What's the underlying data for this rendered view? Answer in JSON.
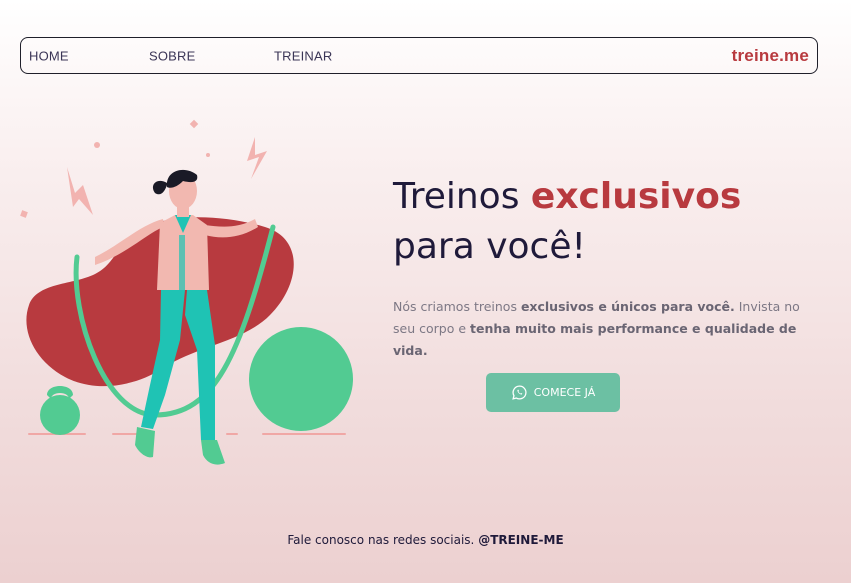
{
  "nav": {
    "home": "HOME",
    "sobre": "SOBRE",
    "treinar": "TREINAR",
    "brand": "treine.me"
  },
  "hero": {
    "title_part1": "Treinos ",
    "title_accent": "exclusivos",
    "title_part2": "para você!",
    "desc_part1": "Nós criamos treinos ",
    "desc_bold1": "exclusivos e únicos para você.",
    "desc_part2": " Invista no seu corpo e ",
    "desc_bold2": "tenha muito mais performance e qualidade de vida.",
    "cta_label": "COMECE JÁ",
    "cta_icon": "whatsapp-icon"
  },
  "footer": {
    "text": "Fale conosco nas redes sociais. ",
    "handle": "@TREINE-ME"
  },
  "colors": {
    "accent": "#b83a3f",
    "cta": "#6cc0a3",
    "dark": "#1f1a3a",
    "green": "#52cb92",
    "teal": "#22c4b4"
  }
}
